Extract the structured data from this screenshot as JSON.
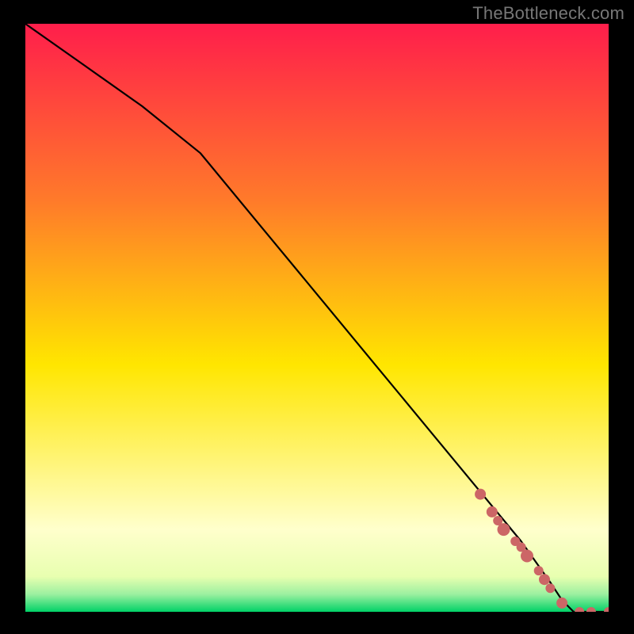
{
  "watermark": "TheBottleneck.com",
  "chart_data": {
    "type": "line",
    "title": "",
    "xlabel": "",
    "ylabel": "",
    "xlim": [
      0,
      100
    ],
    "ylim": [
      0,
      100
    ],
    "grid": false,
    "legend": false,
    "background_gradient_top": "#ff1e4b",
    "background_gradient_mid": "#ffe600",
    "background_gradient_bottom": "#00d267",
    "line_color": "#000000",
    "marker_color": "#cc6666",
    "series": [
      {
        "name": "curve",
        "x": [
          0,
          10,
          20,
          30,
          40,
          50,
          60,
          70,
          80,
          85,
          90,
          92,
          94,
          96,
          98,
          100
        ],
        "y": [
          100,
          93,
          86,
          78,
          66,
          54,
          42,
          30,
          18,
          12,
          5,
          2,
          0,
          0,
          0,
          0
        ]
      }
    ],
    "markers": {
      "x": [
        78,
        80,
        81,
        82,
        84,
        85,
        86,
        88,
        89,
        90,
        92,
        95,
        97,
        100
      ],
      "y": [
        20,
        17,
        15.5,
        14,
        12,
        11,
        9.5,
        7,
        5.5,
        4,
        1.5,
        0,
        0,
        0
      ],
      "r": [
        7,
        7,
        6,
        8,
        6,
        6,
        8,
        6,
        7,
        6,
        7,
        6,
        6,
        6
      ]
    }
  }
}
